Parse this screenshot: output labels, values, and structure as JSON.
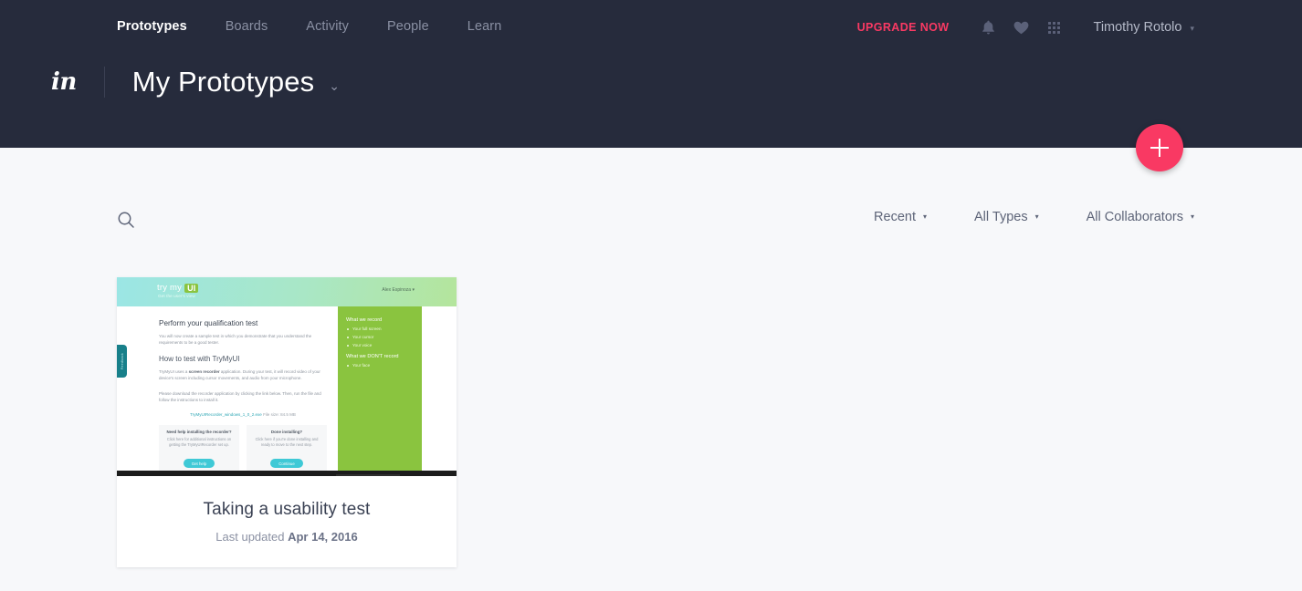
{
  "header": {
    "nav": [
      {
        "label": "Prototypes",
        "active": true
      },
      {
        "label": "Boards",
        "active": false
      },
      {
        "label": "Activity",
        "active": false
      },
      {
        "label": "People",
        "active": false
      },
      {
        "label": "Learn",
        "active": false
      }
    ],
    "upgrade_label": "UPGRADE NOW",
    "icons": [
      "bell-icon",
      "heart-icon",
      "apps-grid-icon"
    ],
    "username": "Timothy Rotolo",
    "user_caret": "▾",
    "logo": "in",
    "page_title": "My Prototypes",
    "title_caret": "⌄",
    "accent_color": "#f93963",
    "background_color": "#262b3c"
  },
  "fab": {
    "label": "+",
    "name": "create-new-button",
    "color": "#f93963"
  },
  "filter_bar": {
    "search_placeholder": "Search",
    "sort": {
      "label": "Recent",
      "caret": "▾"
    },
    "type": {
      "label": "All Types",
      "caret": "▾"
    },
    "collaborators": {
      "label": "All Collaborators",
      "caret": "▾"
    }
  },
  "prototypes": [
    {
      "title": "Taking a usability test",
      "updated_prefix": "Last updated",
      "updated_date": "Apr 14, 2016",
      "thumbnail": {
        "brand_try": "try my",
        "brand_ui": "UI",
        "tagline": "Get the user's view",
        "account": "Alex Espinoza ▾",
        "feedback_tab": "Feedback",
        "heading": "Perform your qualification test",
        "intro": "You will now create a sample test in which you demonstrate that you understand the requirements to be a good tester.",
        "subheading": "How to test with TryMyUI",
        "para1_a": "TryMyUI uses a ",
        "para1_b": "screen recorder",
        "para1_c": " application. During your test, it will record video of your device's screen including cursor movements, and audio from your microphone.",
        "para2": "Please download the recorder application by clicking the link below. Then, run the file and follow the instructions to install it.",
        "download_link": "TryMyUIRecorder_windows_1_0_2.exe",
        "download_size": "File size: 84.5 MB",
        "help_box": {
          "heading": "Need help installing the recorder?",
          "text": "Click here for additional instructions on getting the TryMyUIRecorder set up.",
          "button": "Get help"
        },
        "done_box": {
          "heading": "Done installing?",
          "text": "Click here if you're done installing and ready to move to the next step.",
          "button": "Continue"
        },
        "record_heading": "What we record",
        "record_items": [
          "Your full screen",
          "Your cursor",
          "Your voice"
        ],
        "no_record_heading": "What we DON'T record",
        "no_record_items": [
          "Your face"
        ]
      }
    }
  ]
}
